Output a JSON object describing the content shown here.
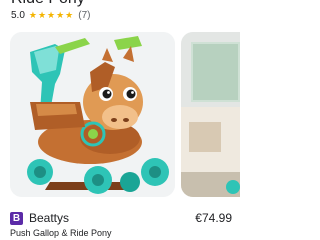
{
  "product": {
    "title": "Ride Pony",
    "rating_value": "5.0",
    "stars": "★★★★★",
    "review_count": "(7)"
  },
  "listing": {
    "seller_logo_letter": "B",
    "seller_name": "Beattys",
    "price": "€74.99",
    "product_name": "Push Gallop & Ride Pony"
  },
  "colors": {
    "seller_brand": "#5b2aa7",
    "star": "#f4b400",
    "toy_teal": "#2ec4b6",
    "toy_brown": "#b86b36",
    "toy_green": "#8bd44a"
  },
  "icons": {
    "rating": "star-icon"
  }
}
